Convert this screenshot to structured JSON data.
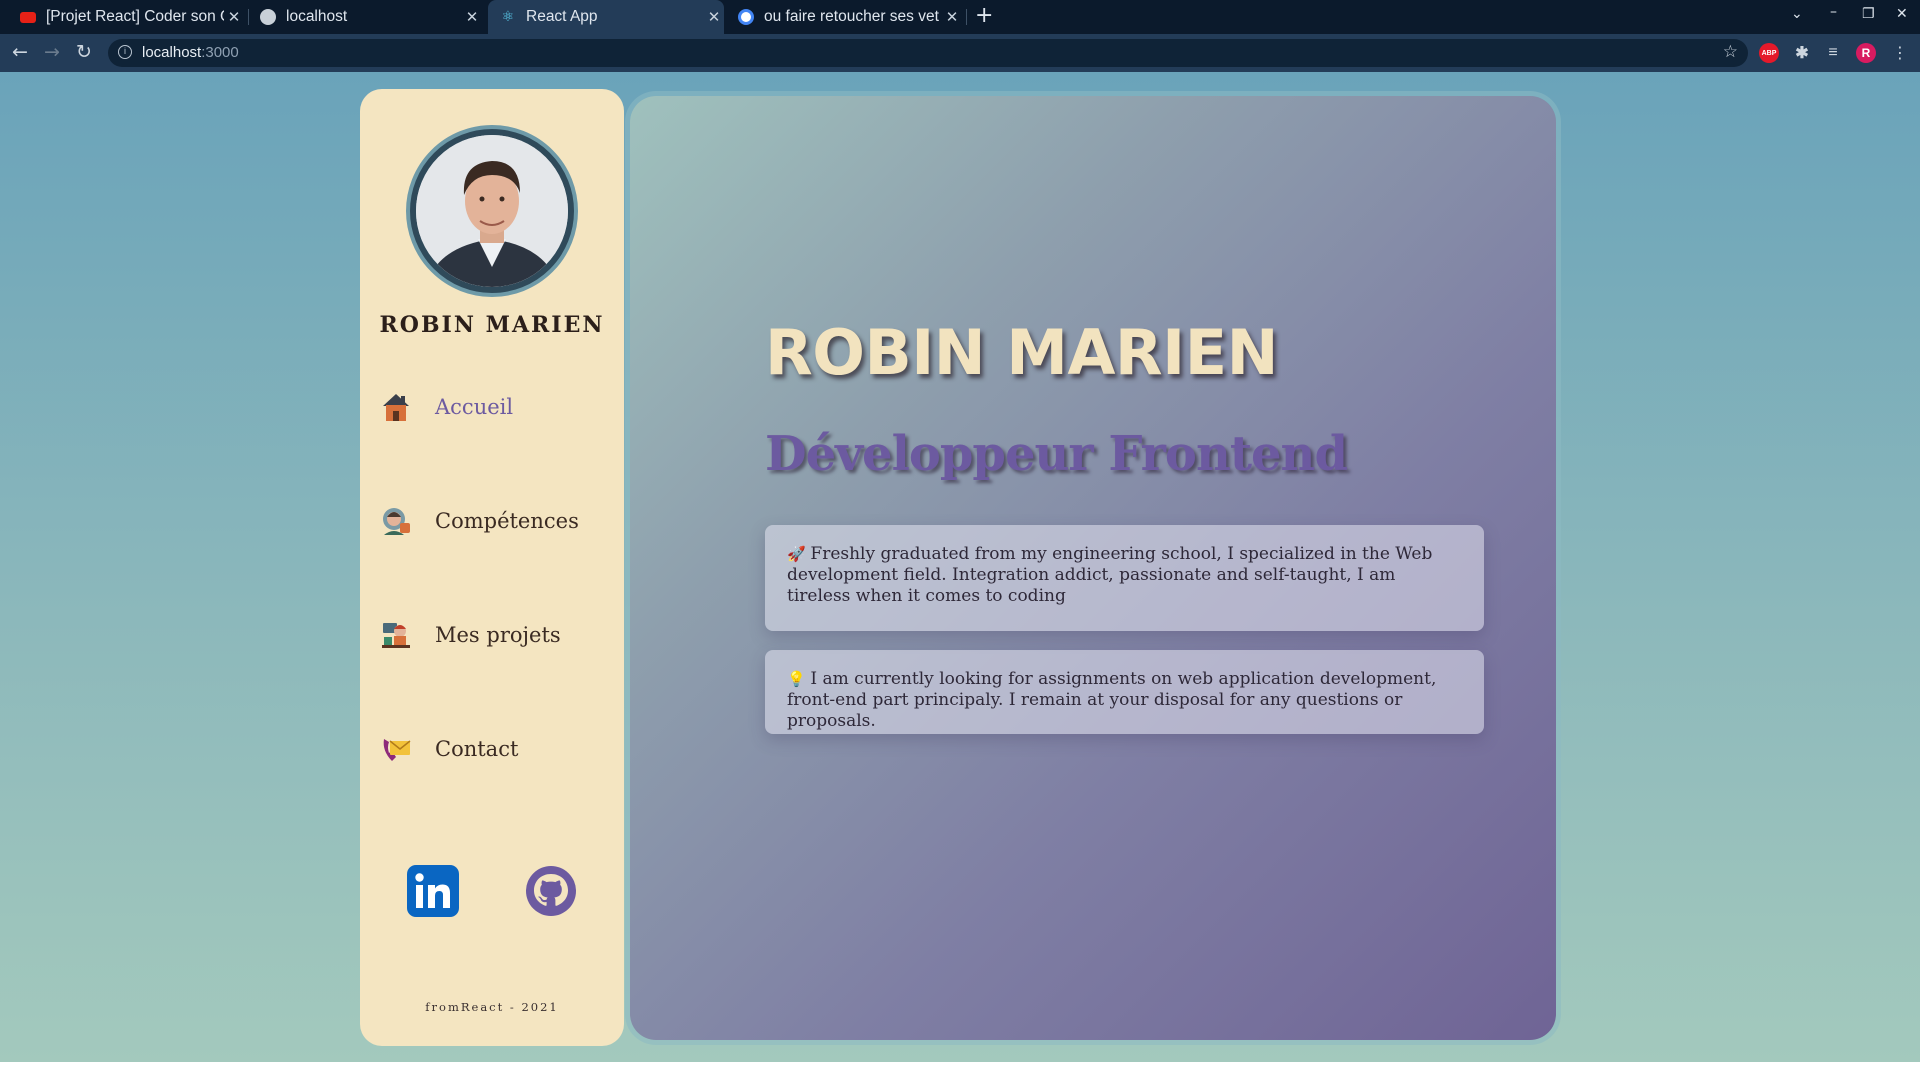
{
  "browser": {
    "tabs": [
      {
        "title": "[Projet React] Coder son C",
        "active": false,
        "favicon_color": "#e62117"
      },
      {
        "title": "localhost",
        "active": false,
        "favicon_color": "#c8d0d8"
      },
      {
        "title": "React App",
        "active": true,
        "favicon_color": "#61dafb"
      },
      {
        "title": "ou faire retoucher ses vet",
        "active": false,
        "favicon_color": "#4285f4"
      }
    ],
    "url_host": "localhost",
    "url_port": ":3000",
    "extensions": [
      {
        "name": "adblock",
        "label": "ABP",
        "color": "#e5192a"
      },
      {
        "name": "puzzle",
        "label": "",
        "color": "#cdd6df"
      },
      {
        "name": "media",
        "label": "",
        "color": "#cdd6df"
      },
      {
        "name": "profile",
        "label": "R",
        "color": "#d81b60"
      }
    ]
  },
  "sidebar": {
    "name": "ROBIN MARIEN",
    "nav": [
      {
        "label": "Accueil",
        "icon": "house-icon",
        "active": true
      },
      {
        "label": "Compétences",
        "icon": "skills-person-icon",
        "active": false
      },
      {
        "label": "Mes projets",
        "icon": "developer-desk-icon",
        "active": false
      },
      {
        "label": "Contact",
        "icon": "phone-mail-icon",
        "active": false
      }
    ],
    "social": [
      {
        "name": "linkedin-icon",
        "color": "#0a66c2"
      },
      {
        "name": "github-icon",
        "color": "#6c5aa0"
      }
    ],
    "footer": "fromReact - 2021"
  },
  "main": {
    "title": "ROBIN MARIEN",
    "role": "Développeur Frontend",
    "cards": [
      {
        "emoji": "🚀",
        "text": "Freshly graduated from my engineering school, I specialized in the Web development field. Integration addict, passionate and self-taught, I am tireless when it comes to coding"
      },
      {
        "emoji": "💡",
        "text": "I am currently looking for assignments on web application development, front-end part principaly. I remain at your disposal for any questions or proposals."
      }
    ]
  },
  "colors": {
    "accent": "#6c5aa0",
    "sidebar_bg": "#f4e5c1",
    "title_cream": "#f2e3bf"
  }
}
